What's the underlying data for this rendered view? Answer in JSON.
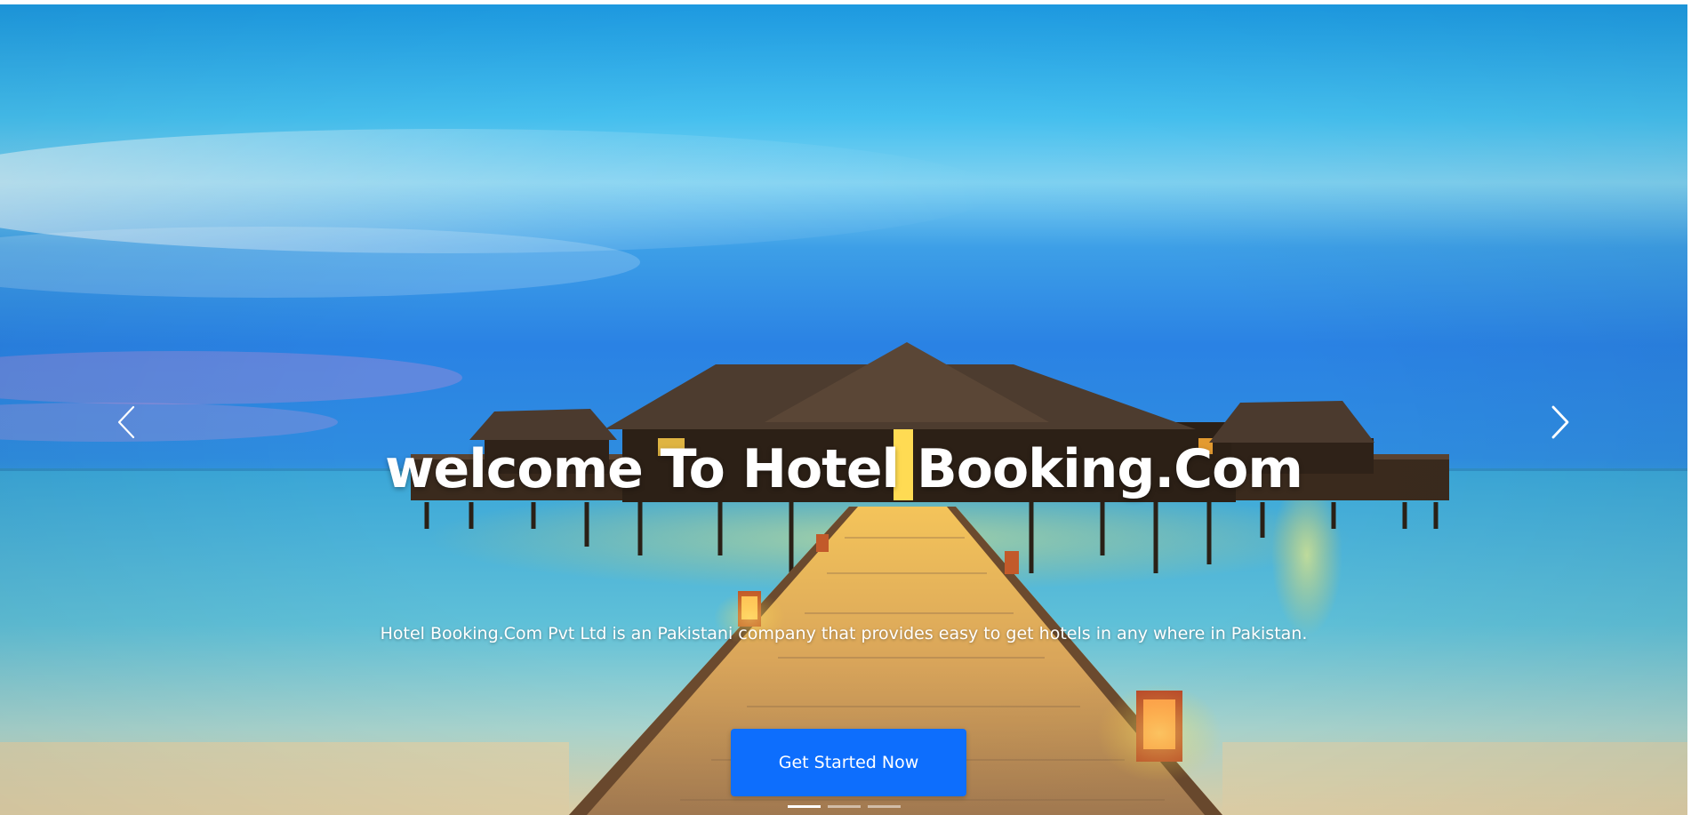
{
  "carousel": {
    "title": "welcome To Hotel Booking.Com",
    "description": "Hotel Booking.Com Pvt Ltd is an Pakistani company that provides easy to get hotels in any where in Pakistan.",
    "cta_label": "Get Started Now",
    "prev_icon": "chevron-left-icon",
    "next_icon": "chevron-right-icon",
    "slide_count": 3,
    "active_slide": 1,
    "scene": "overwater villa with lit wooden boardwalk over turquoise sea at dusk"
  },
  "colors": {
    "accent": "#0d6efd",
    "caption_text": "#ffffff"
  }
}
